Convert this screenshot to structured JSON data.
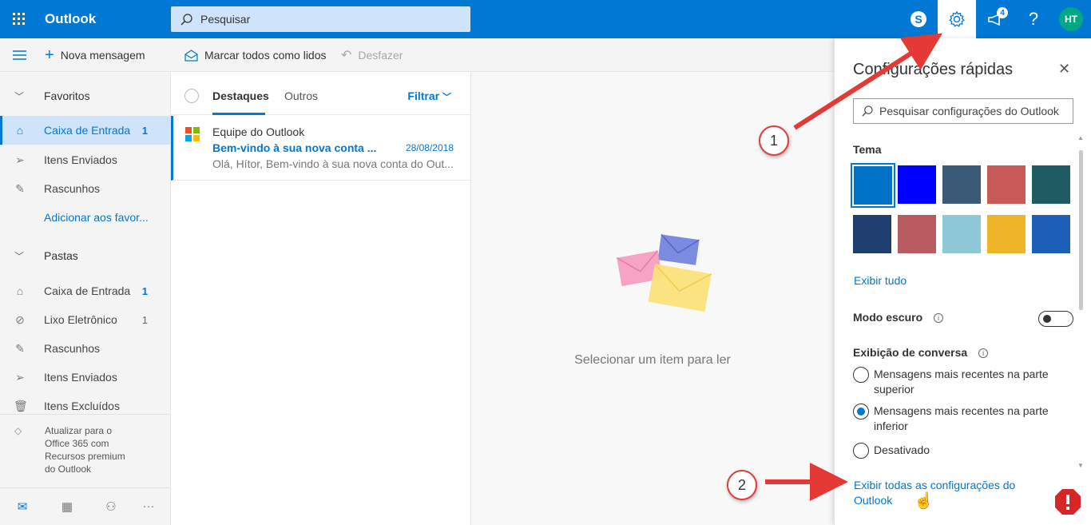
{
  "topbar": {
    "brand": "Outlook",
    "search_placeholder": "Pesquisar",
    "notification_count": "4",
    "help_label": "?",
    "avatar_initials": "HT",
    "accent_color": "#0078d4"
  },
  "commands": {
    "new_message": "Nova mensagem",
    "mark_all_read": "Marcar todos como lidos",
    "undo": "Desfazer"
  },
  "nav": {
    "favorites_header": "Favoritos",
    "favorites": [
      {
        "label": "Caixa de Entrada",
        "count": "1",
        "icon": "inbox-icon"
      },
      {
        "label": "Itens Enviados",
        "icon": "send-icon"
      },
      {
        "label": "Rascunhos",
        "icon": "pencil-icon"
      }
    ],
    "add_favorite": "Adicionar aos favor...",
    "folders_header": "Pastas",
    "folders": [
      {
        "label": "Caixa de Entrada",
        "count": "1",
        "icon": "inbox-icon"
      },
      {
        "label": "Lixo Eletrônico",
        "count": "1",
        "icon": "block-icon"
      },
      {
        "label": "Rascunhos",
        "icon": "pencil-icon"
      },
      {
        "label": "Itens Enviados",
        "icon": "send-icon"
      },
      {
        "label": "Itens Excluídos",
        "icon": "trash-icon"
      }
    ],
    "upgrade_lines": [
      "Atualizar para o",
      "Office 365 com",
      "Recursos premium",
      "do Outlook"
    ]
  },
  "message_list": {
    "tabs": [
      "Destaques",
      "Outros"
    ],
    "filter": "Filtrar",
    "messages": [
      {
        "sender": "Equipe do Outlook",
        "subject": "Bem-vindo à sua nova conta ...",
        "date": "28/08/2018",
        "preview": "Olá, Hítor, Bem-vindo à sua nova conta do Out..."
      }
    ]
  },
  "reading_pane": {
    "empty_text": "Selecionar um item para ler"
  },
  "quick_settings": {
    "title": "Configurações rápidas",
    "search_placeholder": "Pesquisar configurações do Outlook",
    "theme_header": "Tema",
    "themes": [
      {
        "name": "blue",
        "color": "#0072c6"
      },
      {
        "name": "bright-blue",
        "color": "#0000ff"
      },
      {
        "name": "mountains",
        "color": "#3a5a78"
      },
      {
        "name": "palms",
        "color": "#c95a5a"
      },
      {
        "name": "circuit",
        "color": "#1f5b63"
      },
      {
        "name": "innovation",
        "color": "#1e3f70"
      },
      {
        "name": "bokeh",
        "color": "#b85c62"
      },
      {
        "name": "waves",
        "color": "#8fc8d8"
      },
      {
        "name": "starfish",
        "color": "#f0b429"
      },
      {
        "name": "abstract-blue",
        "color": "#1c5fb8"
      }
    ],
    "show_all": "Exibir tudo",
    "dark_mode_label": "Modo escuro",
    "conversation_label": "Exibição de conversa",
    "conversation_options": [
      {
        "label": "Mensagens mais recentes na parte superior",
        "selected": false
      },
      {
        "label": "Mensagens mais recentes na parte inferior",
        "selected": true
      },
      {
        "label": "Desativado",
        "selected": false
      }
    ],
    "all_settings_link": "Exibir todas as configurações do Outlook"
  },
  "annotations": {
    "callout_1": "1",
    "callout_2": "2"
  }
}
